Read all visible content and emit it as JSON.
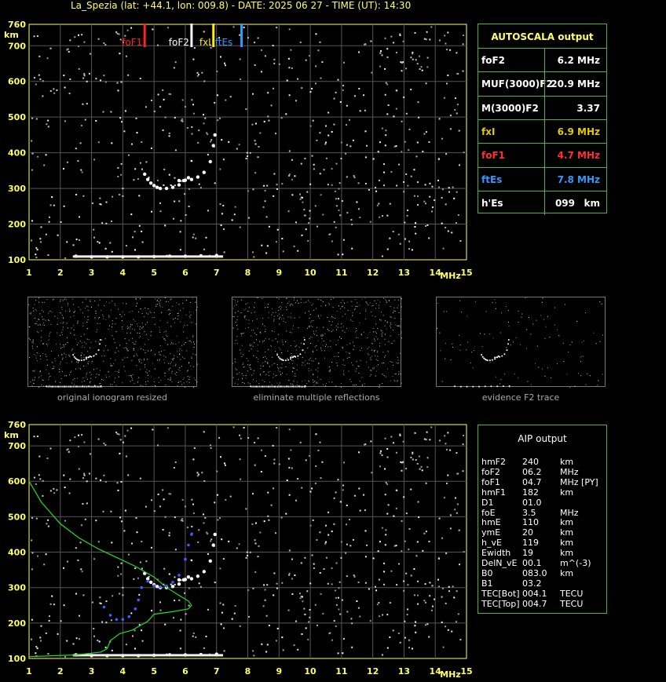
{
  "header": {
    "title": "La_Spezia (lat: +44.1, lon: 009.8) - DATE: 2025 06 27 - TIME (UT): 14:30"
  },
  "axis": {
    "x_ticks": [
      "1",
      "2",
      "3",
      "4",
      "5",
      "6",
      "7",
      "8",
      "9",
      "10",
      "11",
      "12",
      "13",
      "14",
      "15"
    ],
    "x_unit": "MHz",
    "y_ticks": [
      "100",
      "200",
      "300",
      "400",
      "500",
      "600",
      "700",
      "760"
    ],
    "y_unit": "km"
  },
  "markers": {
    "foF1": {
      "label": "foF1",
      "color": "#ff2222"
    },
    "foF2": {
      "label": "foF2",
      "color": "#ffffff"
    },
    "fxI": {
      "label": "fxI",
      "color": "#ffee00"
    },
    "ftEs": {
      "label": "ftEs",
      "color": "#3399ff"
    }
  },
  "autoscala": {
    "title": "AUTOSCALA output",
    "rows": [
      {
        "key": "foF2",
        "value": "6.2 MHz",
        "color": "#ffffff"
      },
      {
        "key": "MUF(3000)F2",
        "value": "20.9 MHz",
        "color": "#ffffff"
      },
      {
        "key": "M(3000)F2",
        "value": "3.37",
        "color": "#ffffff"
      },
      {
        "key": "fxI",
        "value": "6.9 MHz",
        "color": "#e6c800"
      },
      {
        "key": "foF1",
        "value": "4.7 MHz",
        "color": "#ff3030"
      },
      {
        "key": "ftEs",
        "value": "7.8 MHz",
        "color": "#3399ff"
      },
      {
        "key": "h'Es",
        "value": "099",
        "unit": "km",
        "color": "#ffffff"
      }
    ]
  },
  "thumbnails": [
    {
      "caption": "original ionogram resized"
    },
    {
      "caption": "eliminate multiple reflections"
    },
    {
      "caption": "evidence F2 trace"
    }
  ],
  "aip": {
    "title": "AIP output",
    "rows": [
      {
        "k": "hmF2",
        "v": "240",
        "u": "km"
      },
      {
        "k": "foF2",
        "v": "06.2",
        "u": "MHz"
      },
      {
        "k": "foF1",
        "v": "04.7",
        "u": "MHz   [PY]"
      },
      {
        "k": "hmF1",
        "v": "182",
        "u": "km"
      },
      {
        "k": "D1",
        "v": "01.0",
        "u": ""
      },
      {
        "k": "foE",
        "v": "  3.5",
        "u": "MHz"
      },
      {
        "k": "hmE",
        "v": "110",
        "u": "km"
      },
      {
        "k": "ymE",
        "v": "20",
        "u": "km"
      },
      {
        "k": "h_vE",
        "v": "119",
        "u": "km"
      },
      {
        "k": "Ewidth",
        "v": "19",
        "u": "km"
      },
      {
        "k": "DelN_vE",
        "v": "00.1",
        "u": "m^(-3)"
      },
      {
        "k": "B0",
        "v": "083.0",
        "u": "km"
      },
      {
        "k": "B1",
        "v": "03.2",
        "u": ""
      },
      {
        "k": "TEC[Bot]",
        "v": "004.1",
        "u": "TECU"
      },
      {
        "k": "TEC[Top]",
        "v": "004.7",
        "u": "TECU"
      }
    ]
  },
  "chart_data": [
    {
      "type": "scatter",
      "title": "",
      "xlim": [
        1,
        15
      ],
      "ylim": [
        100,
        760
      ],
      "xlabel": "MHz",
      "ylabel": "km",
      "grid": true,
      "series": [
        {
          "name": "",
          "values": [
            [
              4.7,
              340
            ],
            [
              4.8,
              325
            ],
            [
              4.9,
              315
            ],
            [
              5.0,
              308
            ],
            [
              5.1,
              303
            ],
            [
              5.2,
              300
            ],
            [
              5.4,
              300
            ],
            [
              5.6,
              303
            ],
            [
              5.8,
              310
            ],
            [
              5.95,
              322
            ],
            [
              6.1,
              330
            ]
          ]
        },
        {
          "name": "",
          "values": [
            [
              5.8,
              322
            ],
            [
              6.0,
              323
            ],
            [
              6.2,
              325
            ],
            [
              6.4,
              332
            ],
            [
              6.6,
              345
            ],
            [
              6.8,
              375
            ],
            [
              6.9,
              420
            ],
            [
              6.95,
              450
            ]
          ]
        },
        {
          "name": "",
          "values": [
            [
              2.5,
              110
            ],
            [
              3.0,
              108
            ],
            [
              3.5,
              108
            ],
            [
              4.0,
              108
            ],
            [
              4.5,
              108
            ],
            [
              5.0,
              109
            ],
            [
              5.5,
              110
            ],
            [
              6.0,
              110
            ],
            [
              6.5,
              111
            ],
            [
              7.0,
              112
            ]
          ]
        }
      ],
      "vlines": [
        {
          "name": "foF1",
          "x": 4.7
        },
        {
          "name": "foF2",
          "x": 6.2
        },
        {
          "name": "fxI",
          "x": 6.9
        },
        {
          "name": "ftEs",
          "x": 7.8
        }
      ]
    },
    {
      "type": "line",
      "title": "",
      "xlim": [
        1,
        15
      ],
      "ylim": [
        100,
        760
      ],
      "xlabel": "MHz",
      "ylabel": "km",
      "grid": true,
      "series": [
        {
          "name": "",
          "values": [
            [
              1.0,
              600
            ],
            [
              1.4,
              540
            ],
            [
              2.0,
              480
            ],
            [
              2.6,
              440
            ],
            [
              3.2,
              410
            ],
            [
              3.8,
              385
            ],
            [
              4.4,
              360
            ],
            [
              5.0,
              330
            ],
            [
              5.4,
              300
            ],
            [
              5.8,
              278
            ],
            [
              6.1,
              262
            ],
            [
              6.2,
              250
            ],
            [
              6.1,
              240
            ],
            [
              5.6,
              232
            ],
            [
              5.0,
              225
            ],
            [
              4.8,
              205
            ],
            [
              4.6,
              195
            ],
            [
              4.3,
              180
            ],
            [
              3.9,
              170
            ],
            [
              3.6,
              150
            ],
            [
              3.5,
              128
            ],
            [
              3.3,
              118
            ],
            [
              2.5,
              110
            ],
            [
              1.0,
              105
            ]
          ]
        },
        {
          "name": "",
          "values": [
            [
              3.4,
              245
            ],
            [
              3.6,
              222
            ],
            [
              3.8,
              210
            ],
            [
              4.0,
              210
            ],
            [
              4.2,
              218
            ],
            [
              4.4,
              240
            ],
            [
              4.5,
              265
            ],
            [
              4.6,
              300
            ],
            [
              4.8,
              318
            ],
            [
              5.0,
              305
            ],
            [
              5.2,
              302
            ],
            [
              5.4,
              305
            ],
            [
              5.6,
              315
            ],
            [
              5.8,
              335
            ],
            [
              6.0,
              380
            ],
            [
              6.1,
              420
            ],
            [
              6.2,
              450
            ]
          ]
        }
      ]
    }
  ]
}
